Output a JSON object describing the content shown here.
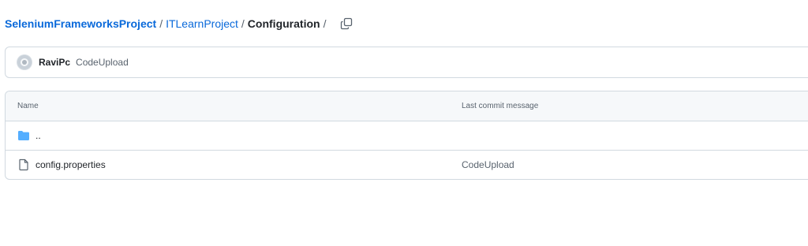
{
  "breadcrumb": {
    "root": "SeleniumFrameworksProject",
    "parent": "ITLearnProject",
    "current": "Configuration",
    "separator": "/",
    "copy_icon": "copy-icon"
  },
  "latest_commit": {
    "author": "RaviPc",
    "message": "CodeUpload",
    "avatar_icon": "avatar-icon"
  },
  "file_table": {
    "columns": {
      "name": "Name",
      "last_commit_message": "Last commit message"
    },
    "rows": [
      {
        "name": "..",
        "icon": "folder-icon",
        "message": ""
      },
      {
        "name": "config.properties",
        "icon": "file-icon",
        "message": "CodeUpload"
      }
    ]
  },
  "colors": {
    "link": "#0969da",
    "folder": "#54aeff",
    "border": "#d1d9e0",
    "muted": "#59636e"
  }
}
